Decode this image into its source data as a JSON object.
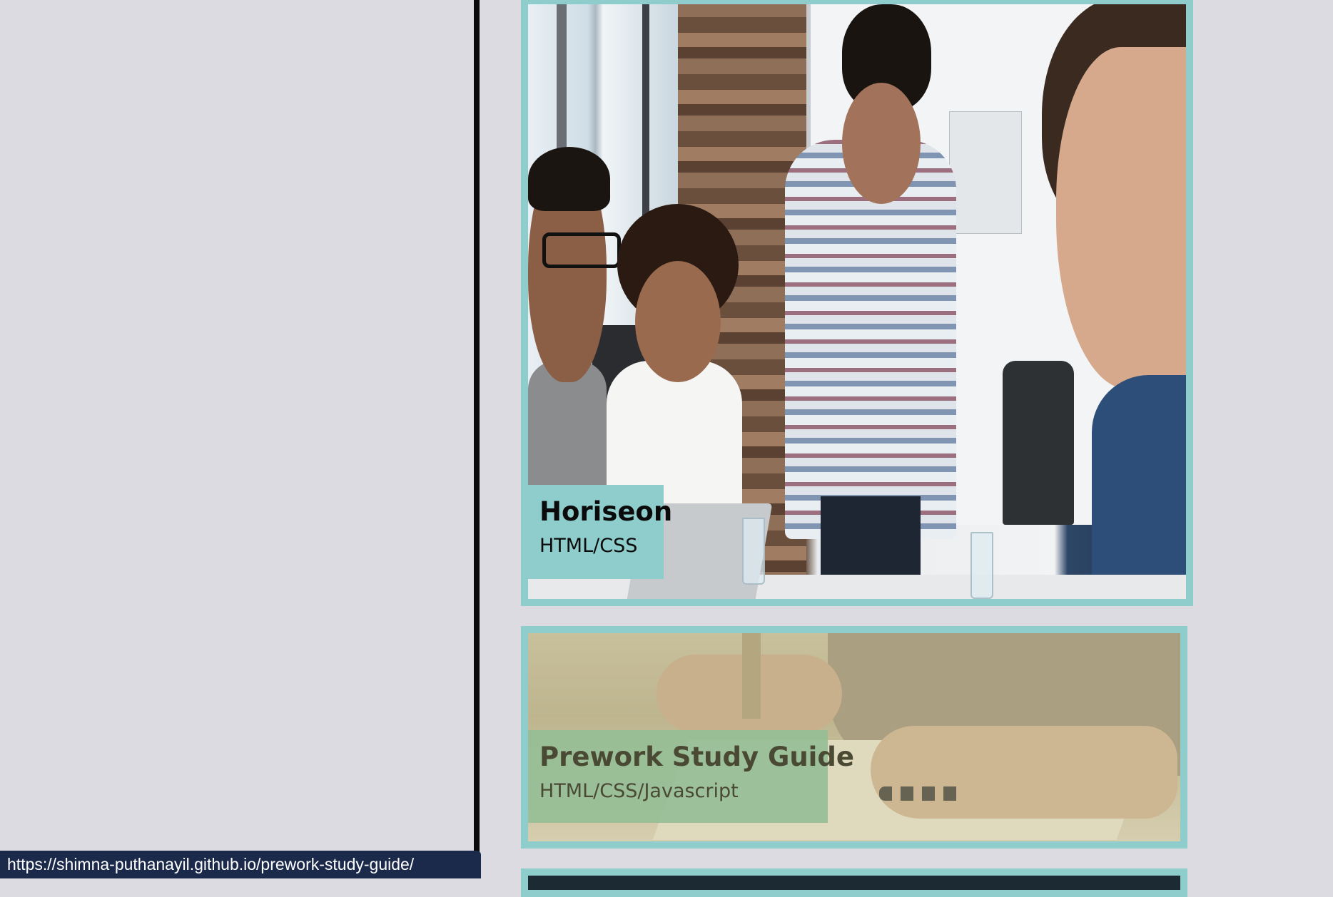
{
  "projects": [
    {
      "title": "Horiseon",
      "subtitle": "HTML/CSS"
    },
    {
      "title": "Prework Study Guide",
      "subtitle": "HTML/CSS/Javascript"
    }
  ],
  "status_bar": {
    "url": "https://shimna-puthanayil.github.io/prework-study-guide/"
  },
  "colors": {
    "card_border": "#8ecdcc",
    "page_background": "#dcdbe1",
    "divider": "#0a0a0a",
    "status_bar_bg": "#1b2a4a"
  }
}
